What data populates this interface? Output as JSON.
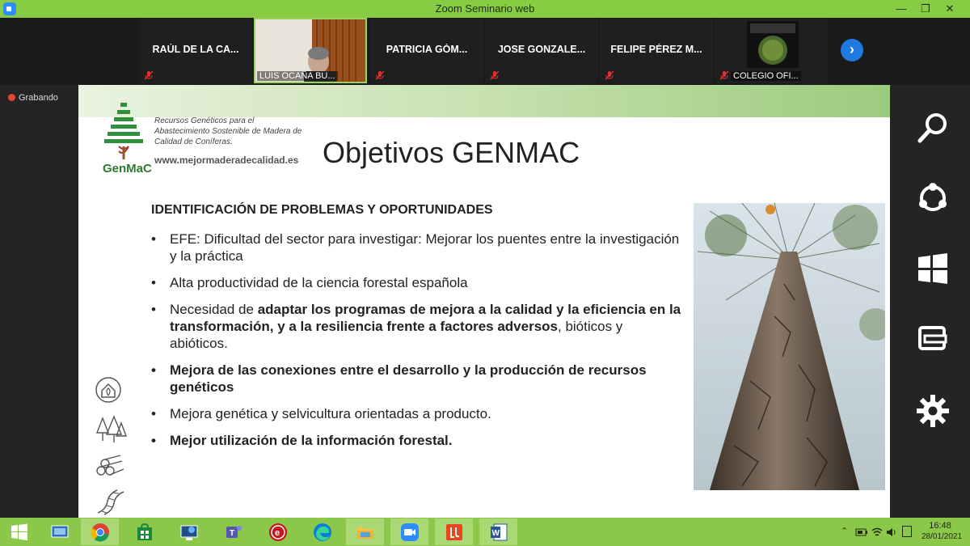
{
  "window": {
    "title": "Zoom Seminario web",
    "minimize": "—",
    "maximize": "❐",
    "close": "✕"
  },
  "participants": [
    {
      "name": "RAÚL DE LA CA..."
    },
    {
      "name": "LUIS OCAÑA BU..."
    },
    {
      "name": "PATRICIA GÓM..."
    },
    {
      "name": "JOSE GONZALE..."
    },
    {
      "name": "FELIPE PÉREZ M..."
    },
    {
      "name": "COLEGIO OFI..."
    }
  ],
  "recording": {
    "label": "Grabando"
  },
  "slide": {
    "logo_lines": [
      "Recursos Genéticos para el",
      "Abastecimiento Sostenible de Madera de",
      "Calidad de Coníferas."
    ],
    "logo_url": "www.mejormaderadecalidad.es",
    "logo_name": "GenMaC",
    "title": "Objetivos GENMAC",
    "heading": "IDENTIFICACIÓN DE PROBLEMAS Y OPORTUNIDADES",
    "bullets": [
      {
        "p1": "EFE: Dificultad del sector para investigar: Mejorar los puentes entre la investigación y la práctica"
      },
      {
        "p1": "Alta productividad de la ciencia forestal española"
      },
      {
        "p1": "Necesidad de ",
        "p2": "adaptar los programas de mejora a la calidad y la eficiencia en la transformación, y a la resiliencia frente a factores adversos",
        "p3": ", bióticos y abióticos."
      },
      {
        "p2": "Mejora de las conexiones entre el desarrollo y la producción de recursos genéticos"
      },
      {
        "p1": "Mejora genética y selvicultura orientadas a producto."
      },
      {
        "p2": "Mejor utilización de la información forestal."
      }
    ]
  },
  "taskbar": {
    "apps": [
      "windows-start",
      "chrome",
      "store",
      "remote-desktop",
      "teams",
      "app-e",
      "edge",
      "file-explorer",
      "zoom",
      "app-orange",
      "word"
    ],
    "time": "16:48",
    "date": "28/01/2021"
  },
  "colors": {
    "accent": "#88cc44",
    "zoom_blue": "#1f7ae0"
  }
}
